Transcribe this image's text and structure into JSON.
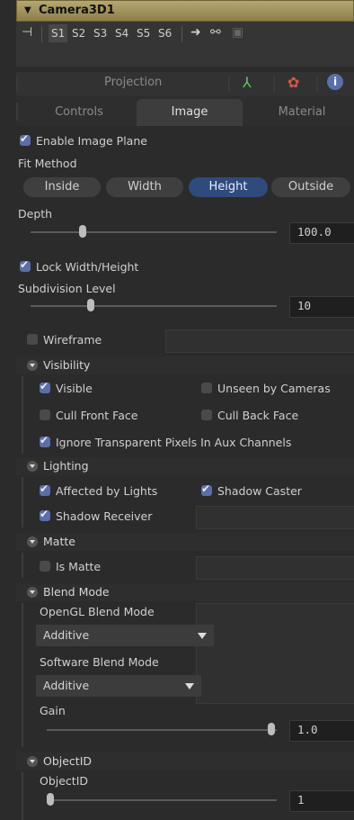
{
  "header": {
    "title": "Camera3D1"
  },
  "toolbar": {
    "slots": [
      "S1",
      "S2",
      "S3",
      "S4",
      "S5",
      "S6"
    ]
  },
  "projection_tab": "Projection",
  "tabs": {
    "controls": "Controls",
    "image": "Image",
    "material": "Material"
  },
  "image_plane": {
    "enable_label": "Enable Image Plane",
    "fit_method_label": "Fit Method",
    "fit_buttons": [
      "Inside",
      "Width",
      "Height",
      "Outside"
    ],
    "fit_selected": "Height",
    "depth_label": "Depth",
    "depth_value": "100.0",
    "lock_label": "Lock Width/Height",
    "subdiv_label": "Subdivision Level",
    "subdiv_value": "10",
    "wireframe_label": "Wireframe"
  },
  "visibility": {
    "header": "Visibility",
    "visible": "Visible",
    "unseen": "Unseen by Cameras",
    "cull_front": "Cull Front Face",
    "cull_back": "Cull Back Face",
    "ignore_transparent": "Ignore Transparent Pixels In Aux Channels"
  },
  "lighting": {
    "header": "Lighting",
    "affected": "Affected by Lights",
    "shadow_caster": "Shadow Caster",
    "shadow_receiver": "Shadow Receiver"
  },
  "matte": {
    "header": "Matte",
    "is_matte": "Is Matte"
  },
  "blend": {
    "header": "Blend Mode",
    "opengl_label": "OpenGL Blend Mode",
    "opengl_value": "Additive",
    "software_label": "Software Blend Mode",
    "software_value": "Additive",
    "gain_label": "Gain",
    "gain_value": "1.0"
  },
  "objectid": {
    "header": "ObjectID",
    "label": "ObjectID",
    "value": "1"
  },
  "colors": {
    "accent": "#2f4a7d",
    "title_bar": "#b7a772",
    "checkbox_on": "#5b6fa6"
  },
  "slider_levels": {
    "depth": 0.21,
    "subdivision": 0.25,
    "gain": 1.0,
    "objectid": 0.0
  }
}
